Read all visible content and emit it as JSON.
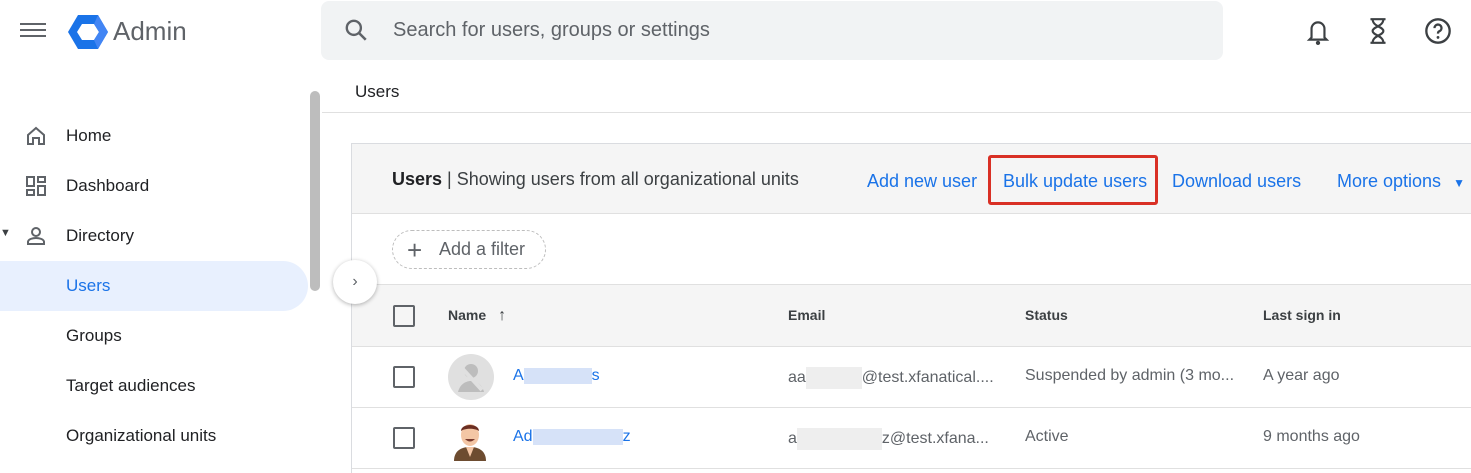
{
  "app": {
    "title": "Admin",
    "brand_color": "#1a73e8"
  },
  "search": {
    "placeholder": "Search for users, groups or settings"
  },
  "top_icons": [
    "bell-icon",
    "hourglass-icon",
    "help-icon"
  ],
  "sidebar": {
    "items": [
      {
        "label": "Home",
        "icon": "home-icon"
      },
      {
        "label": "Dashboard",
        "icon": "dashboard-icon"
      },
      {
        "label": "Directory",
        "icon": "person-icon"
      },
      {
        "label": "Users",
        "active": true
      },
      {
        "label": "Groups"
      },
      {
        "label": "Target audiences"
      },
      {
        "label": "Organizational units"
      }
    ]
  },
  "breadcrumb": "Users",
  "panel": {
    "title": "Users",
    "subtitle": " | Showing users from all organizational units",
    "actions": {
      "add": "Add new user",
      "bulk": "Bulk update users",
      "download": "Download users",
      "more": "More options"
    },
    "filter": "Add a filter",
    "columns": {
      "name": "Name",
      "email": "Email",
      "status": "Status",
      "last_sign_in": "Last sign in"
    },
    "rows": [
      {
        "name_start": "A",
        "name_end": "s",
        "email_start": "aa",
        "email_end": "@test.xfanatical....",
        "status": "Suspended by admin (3 mo...",
        "last_sign_in": "A year ago"
      },
      {
        "name_start": "Ad",
        "name_end": "z",
        "email_start": "a",
        "email_end": "z@test.xfana...",
        "status": "Active",
        "last_sign_in": "9 months ago"
      }
    ]
  },
  "highlight_color": "#d93025"
}
